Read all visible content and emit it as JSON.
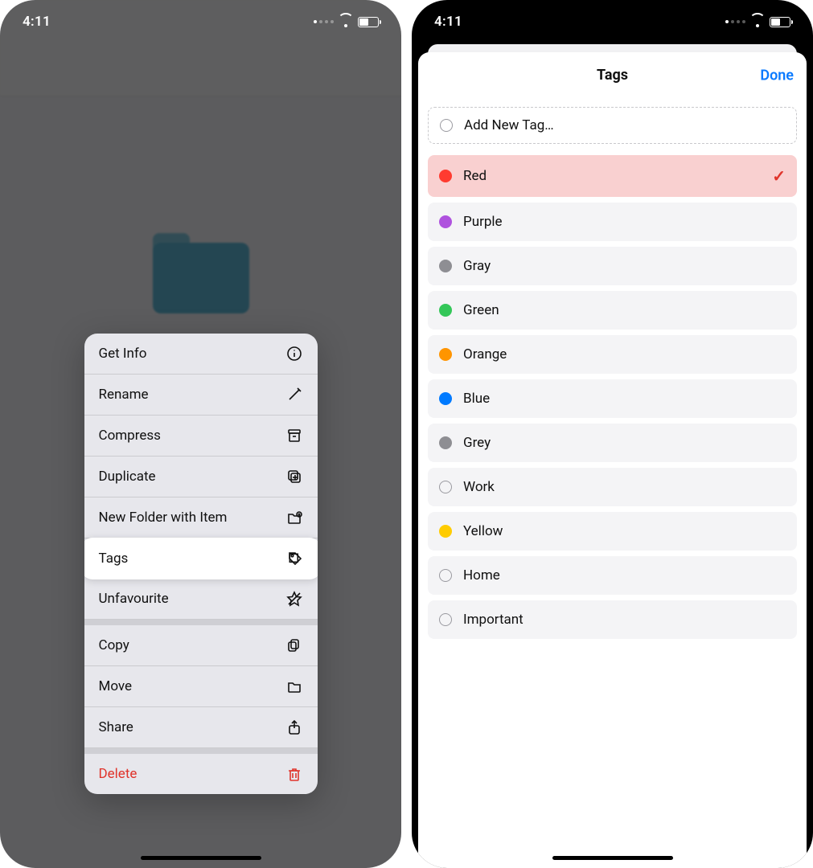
{
  "status": {
    "time": "4:11"
  },
  "left": {
    "header_title": "",
    "menu": {
      "items": [
        {
          "id": "get-info",
          "label": "Get Info",
          "icon": "info",
          "danger": false,
          "highlighted": false,
          "group_sep": false
        },
        {
          "id": "rename",
          "label": "Rename",
          "icon": "pencil",
          "danger": false,
          "highlighted": false,
          "group_sep": false
        },
        {
          "id": "compress",
          "label": "Compress",
          "icon": "archive",
          "danger": false,
          "highlighted": false,
          "group_sep": false
        },
        {
          "id": "duplicate",
          "label": "Duplicate",
          "icon": "duplicate",
          "danger": false,
          "highlighted": false,
          "group_sep": false
        },
        {
          "id": "newfolder",
          "label": "New Folder with Item",
          "icon": "folderplus",
          "danger": false,
          "highlighted": false,
          "group_sep": false
        },
        {
          "id": "tags",
          "label": "Tags",
          "icon": "tag",
          "danger": false,
          "highlighted": true,
          "group_sep": false
        },
        {
          "id": "unfav",
          "label": "Unfavourite",
          "icon": "starx",
          "danger": false,
          "highlighted": false,
          "group_sep": false
        },
        {
          "id": "copy",
          "label": "Copy",
          "icon": "copy",
          "danger": false,
          "highlighted": false,
          "group_sep": true
        },
        {
          "id": "move",
          "label": "Move",
          "icon": "folder",
          "danger": false,
          "highlighted": false,
          "group_sep": false
        },
        {
          "id": "share",
          "label": "Share",
          "icon": "share",
          "danger": false,
          "highlighted": false,
          "group_sep": false
        },
        {
          "id": "delete",
          "label": "Delete",
          "icon": "trash",
          "danger": true,
          "highlighted": false,
          "group_sep": true
        }
      ]
    }
  },
  "right": {
    "title": "Tags",
    "done": "Done",
    "add_label": "Add New Tag…",
    "tags": [
      {
        "label": "Red",
        "color": "#ff3b30",
        "hollow": false,
        "selected": true
      },
      {
        "label": "Purple",
        "color": "#af52de",
        "hollow": false,
        "selected": false
      },
      {
        "label": "Gray",
        "color": "#8e8e93",
        "hollow": false,
        "selected": false
      },
      {
        "label": "Green",
        "color": "#34c759",
        "hollow": false,
        "selected": false
      },
      {
        "label": "Orange",
        "color": "#ff9500",
        "hollow": false,
        "selected": false
      },
      {
        "label": "Blue",
        "color": "#007aff",
        "hollow": false,
        "selected": false
      },
      {
        "label": "Grey",
        "color": "#8e8e93",
        "hollow": false,
        "selected": false
      },
      {
        "label": "Work",
        "color": "",
        "hollow": true,
        "selected": false
      },
      {
        "label": "Yellow",
        "color": "#ffcc00",
        "hollow": false,
        "selected": false
      },
      {
        "label": "Home",
        "color": "",
        "hollow": true,
        "selected": false
      },
      {
        "label": "Important",
        "color": "",
        "hollow": true,
        "selected": false
      }
    ]
  }
}
